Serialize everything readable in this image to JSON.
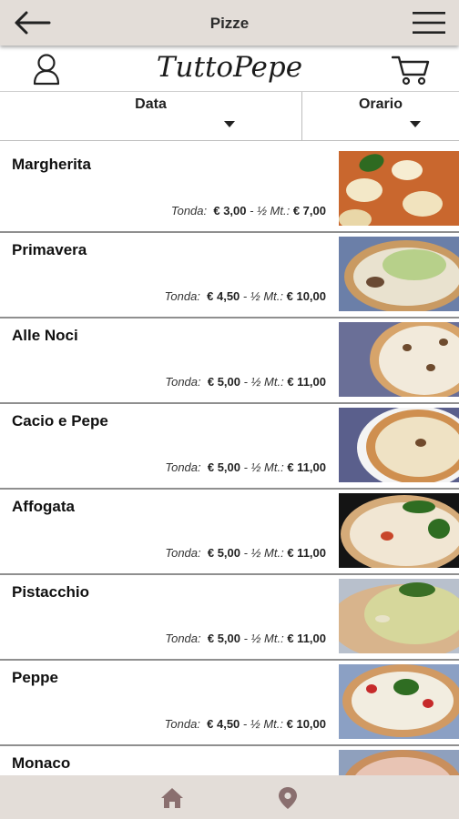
{
  "header": {
    "title": "Pizze",
    "back_icon": "arrow-left-icon",
    "menu_icon": "hamburger-menu-icon"
  },
  "brand": {
    "logo_text": "TuttoPepe",
    "user_icon": "user-icon",
    "cart_icon": "shopping-cart-icon"
  },
  "filters": {
    "date_label": "Data",
    "time_label": "Orario"
  },
  "price_labels": {
    "round": "Tonda:",
    "half_meter": "½ Mt.:"
  },
  "pizzas": [
    {
      "name": "Margherita",
      "round_price": "€ 3,00",
      "half_meter_price": "€ 7,00"
    },
    {
      "name": "Primavera",
      "round_price": "€ 4,50",
      "half_meter_price": "€ 10,00"
    },
    {
      "name": "Alle Noci",
      "round_price": "€ 5,00",
      "half_meter_price": "€ 11,00"
    },
    {
      "name": "Cacio e Pepe",
      "round_price": "€ 5,00",
      "half_meter_price": "€ 11,00"
    },
    {
      "name": "Affogata",
      "round_price": "€ 5,00",
      "half_meter_price": "€ 11,00"
    },
    {
      "name": "Pistacchio",
      "round_price": "€ 5,00",
      "half_meter_price": "€ 11,00"
    },
    {
      "name": "Peppe",
      "round_price": "€ 4,50",
      "half_meter_price": "€ 10,00"
    },
    {
      "name": "Monaco"
    }
  ],
  "footer": {
    "home_icon": "home-icon",
    "location_icon": "location-pin-icon"
  },
  "colors": {
    "bar_background": "#e3ddd8",
    "footer_icon": "#8a6f6f",
    "separator": "#8f8f8f"
  }
}
